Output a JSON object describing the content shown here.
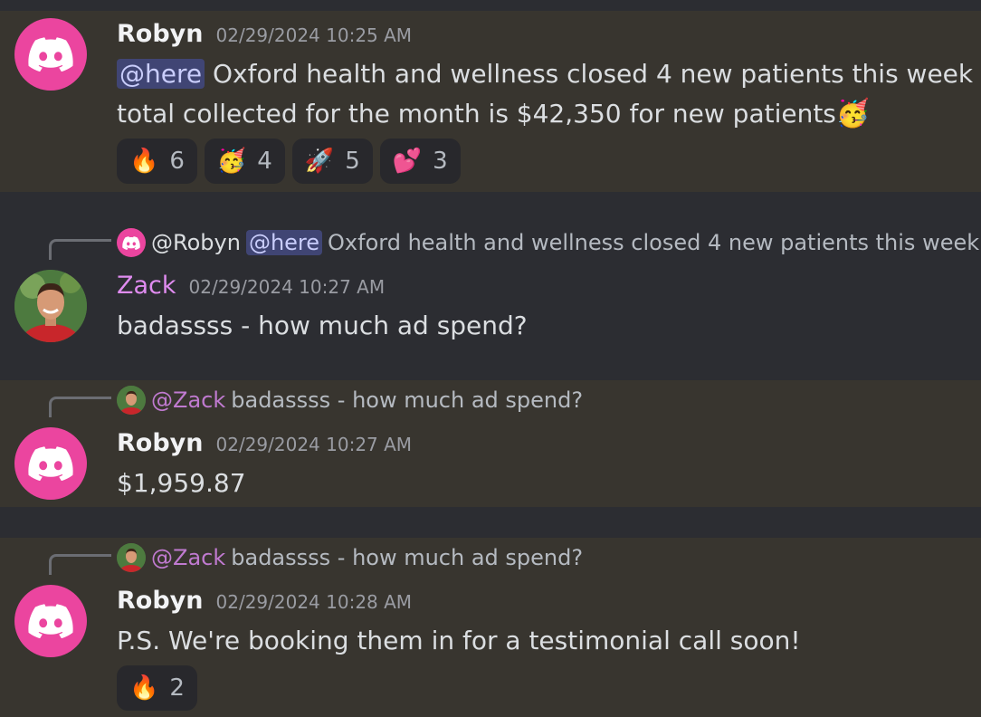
{
  "messages": [
    {
      "author": "Robyn",
      "timestamp": "02/29/2024 10:25 AM",
      "mention": "@here",
      "line1": "Oxford health and wellness closed 4 new patients this week -",
      "line2": "total collected for the month is $42,350 for new patients",
      "inline_emoji": "🥳",
      "reactions": [
        {
          "emoji": "🔥",
          "count": "6"
        },
        {
          "emoji": "🥳",
          "count": "4"
        },
        {
          "emoji": "🚀",
          "count": "5"
        },
        {
          "emoji": "💕",
          "count": "3"
        }
      ]
    },
    {
      "reply": {
        "name": "@Robyn",
        "mention": "@here",
        "text": "Oxford health and wellness closed 4 new patients this week -"
      },
      "author": "Zack",
      "timestamp": "02/29/2024 10:27 AM",
      "text": "badassss - how much ad spend?"
    },
    {
      "reply": {
        "name": "@Zack",
        "text": "badassss - how much ad spend?"
      },
      "author": "Robyn",
      "timestamp": "02/29/2024 10:27 AM",
      "text": "$1,959.87"
    },
    {
      "reply": {
        "name": "@Zack",
        "text": "badassss - how much ad spend?"
      },
      "author": "Robyn",
      "timestamp": "02/29/2024 10:28 AM",
      "text": "P.S. We're booking them in for a testimonial call soon!",
      "reactions": [
        {
          "emoji": "🔥",
          "count": "2"
        }
      ]
    }
  ]
}
